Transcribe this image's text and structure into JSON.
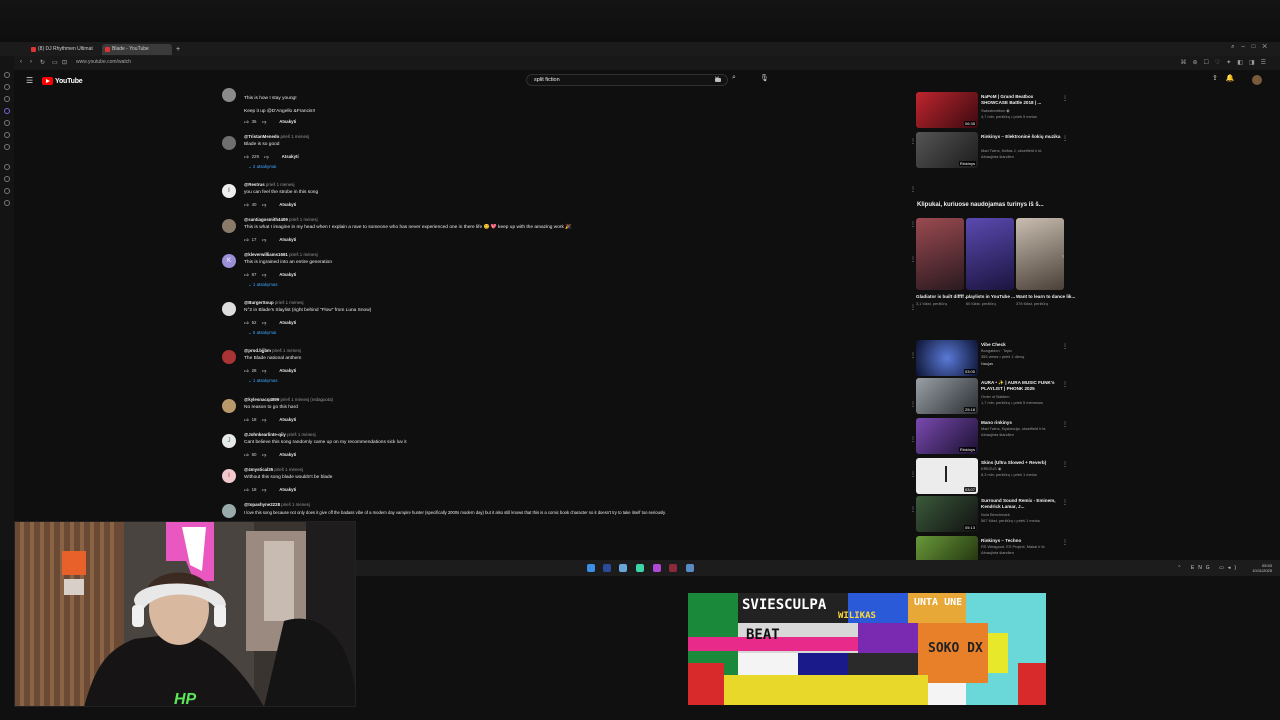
{
  "browser": {
    "tabs": [
      {
        "label": "(8) DJ Rhythmen Ultimat",
        "active": false
      },
      {
        "label": "Blade - YouTube",
        "active": true
      }
    ],
    "new_tab": "+",
    "url": "www.youtube.com/watch"
  },
  "youtube": {
    "logo_text": "YouTube",
    "search_value": "split fiction"
  },
  "comments": [
    {
      "handle": "",
      "ago": "",
      "text": "This is how I stay young!",
      "likes": "",
      "replies": ""
    },
    {
      "handle": "",
      "ago": "",
      "text": "Keep it up @D'Angello &Francis!!",
      "likes": "36",
      "replies": ""
    },
    {
      "handle": "@TristanMenedo",
      "ago": "prieš 1 mėnesį",
      "text": "Blade is so good",
      "likes": "229",
      "replies": "2 atsakymai"
    },
    {
      "handle": "@Restrus",
      "ago": "prieš 1 mėnesį",
      "text": "you can feel the strobe in this song",
      "likes": "40",
      "replies": ""
    },
    {
      "handle": "@santiagosmith4409",
      "ago": "prieš 1 mėnesį",
      "text": "This is what I imagine in my head when I explain a rave to someone who has never experienced one in there life 😊 💖 keep up with the amazing work 🎉",
      "likes": "17",
      "replies": ""
    },
    {
      "handle": "@kleverwilliams1661",
      "ago": "prieš 1 mėnesį",
      "text": "This is ingrained into an entire generation",
      "likes": "87",
      "replies": "1 atsakymas"
    },
    {
      "handle": "@BurgerSoup",
      "ago": "prieš 1 mėnesį",
      "text": "N°2 in Blade's Slaylist (right behind \"Flow\" from Luna Snow)",
      "likes": "52",
      "replies": "5 atsakymai"
    },
    {
      "handle": "@prod.bjjbm",
      "ago": "prieš 1 mėnesį",
      "text": "The Blade national anthem",
      "likes": "28",
      "replies": "1 atsakymas"
    },
    {
      "handle": "@kylesnacq4899",
      "ago": "prieš 1 mėnesį (redaguota)",
      "text": "No reason to go this hard",
      "likes": "18",
      "replies": ""
    },
    {
      "handle": "@Johnkearlinte-qiiy",
      "ago": "prieš 1 mėnesį",
      "text": "Cant believe this song randomly came up on my recommendations sick luv it",
      "likes": "50",
      "replies": ""
    },
    {
      "handle": "@4mystical35",
      "ago": "prieš 1 mėnesį",
      "text": "Without this song blade wouldn't be blade",
      "likes": "18",
      "replies": ""
    },
    {
      "handle": "@topashyne2228",
      "ago": "prieš 1 mėnesį",
      "text": "I love this song because not only does it give off the badass vibe of a modern day vampire hunter (specifically 2000s modern day) but it also still knows that this is a comic book character so it doesn't try to take itself too seriously.",
      "likes": "",
      "replies": ""
    }
  ],
  "reply_label": "Atsakyti",
  "related_top": [
    {
      "title": "NaPoM | Grand Beatbox SHOWCASE Battle 2018 | ...",
      "channel": "Swissbeatbox ◉",
      "stats": "4,7 mln. peržiūrų • prieš 9 metus",
      "duration": "06:35",
      "thumb_color": "#c0252e"
    },
    {
      "title": "Rinkinys – Elektroninė šokių muzika",
      "channel": "Mad Twins, Nellas J, okseifield ir kt.",
      "stats": "Atnaujinta šiandien",
      "duration": "Rinkinys",
      "thumb_color": "#3a3a3a"
    }
  ],
  "shorts": {
    "heading": "Klipukai, kuriuose naudojamas turinys iš š...",
    "items": [
      {
        "title": "Gladiator is built diffff ...",
        "views": "3,1 tūkst. peržiūrų",
        "color": "#6b3a3f"
      },
      {
        "title": "playlists in YouTube ...",
        "views": "60 tūkst. peržiūrų",
        "color": "#4a3a8a"
      },
      {
        "title": "Want to learn to dance lik...",
        "views": "378 tūkst. peržiūrų",
        "color": "#8a7a6a"
      }
    ]
  },
  "related_bottom": [
    {
      "title": "Vibe Check",
      "channel": "Bongabion · Topic",
      "stats": "355 views • prieš 1 dieną",
      "badge": "Naujas",
      "duration": "03:05",
      "thumb_color": "#1c2a55"
    },
    {
      "title": "AURA • ✨ | AURA MUSIC FUNK's PLAYLIST | PHONK 2025",
      "channel": "Order of Baldem",
      "stats": "1,7 mln. peržiūrų • prieš 5 mėnesius",
      "badge": "",
      "duration": "25:18",
      "thumb_color": "#5a5f66"
    },
    {
      "title": "Mano rinkinys",
      "channel": "Mad Twins, Kęstancija, okseifield ir kt.",
      "stats": "Atnaujinta šiandien",
      "badge": "",
      "duration": "Rinkinys",
      "thumb_color": "#3a2a5a"
    },
    {
      "title": "Skins (Ultra Slowed + Reverb)",
      "channel": "KREZUS ◉",
      "stats": "8,3 mln. peržiūrų • prieš 1 metus",
      "badge": "",
      "duration": "03:07",
      "thumb_color": "#e8e8e8"
    },
    {
      "title": "Surround Sound Remix - Eminem, Kendrick Lamar, J...",
      "channel": "Nola Benchmark",
      "stats": "567 tūkst. peržiūrų • prieš 1 metus",
      "badge": "",
      "duration": "05:13",
      "thumb_color": "#2a3a2a"
    },
    {
      "title": "Rinkinys – Techno",
      "channel": "RS Weagood, ES Project, Makai ir kt.",
      "stats": "Atnaujinta šiandien",
      "badge": "",
      "duration": "",
      "thumb_color": "#4a6a2a"
    }
  ],
  "taskbar": {
    "tray_lang": "ENG",
    "time": "05:53",
    "date": "10/11/2025"
  },
  "pixel_art": {
    "words": [
      "SVIESCULPA",
      "BEAT",
      "UNTA UNE",
      "SOKO DX",
      "WILIKAS"
    ]
  },
  "webcam": {
    "overlay_text": "HP"
  }
}
